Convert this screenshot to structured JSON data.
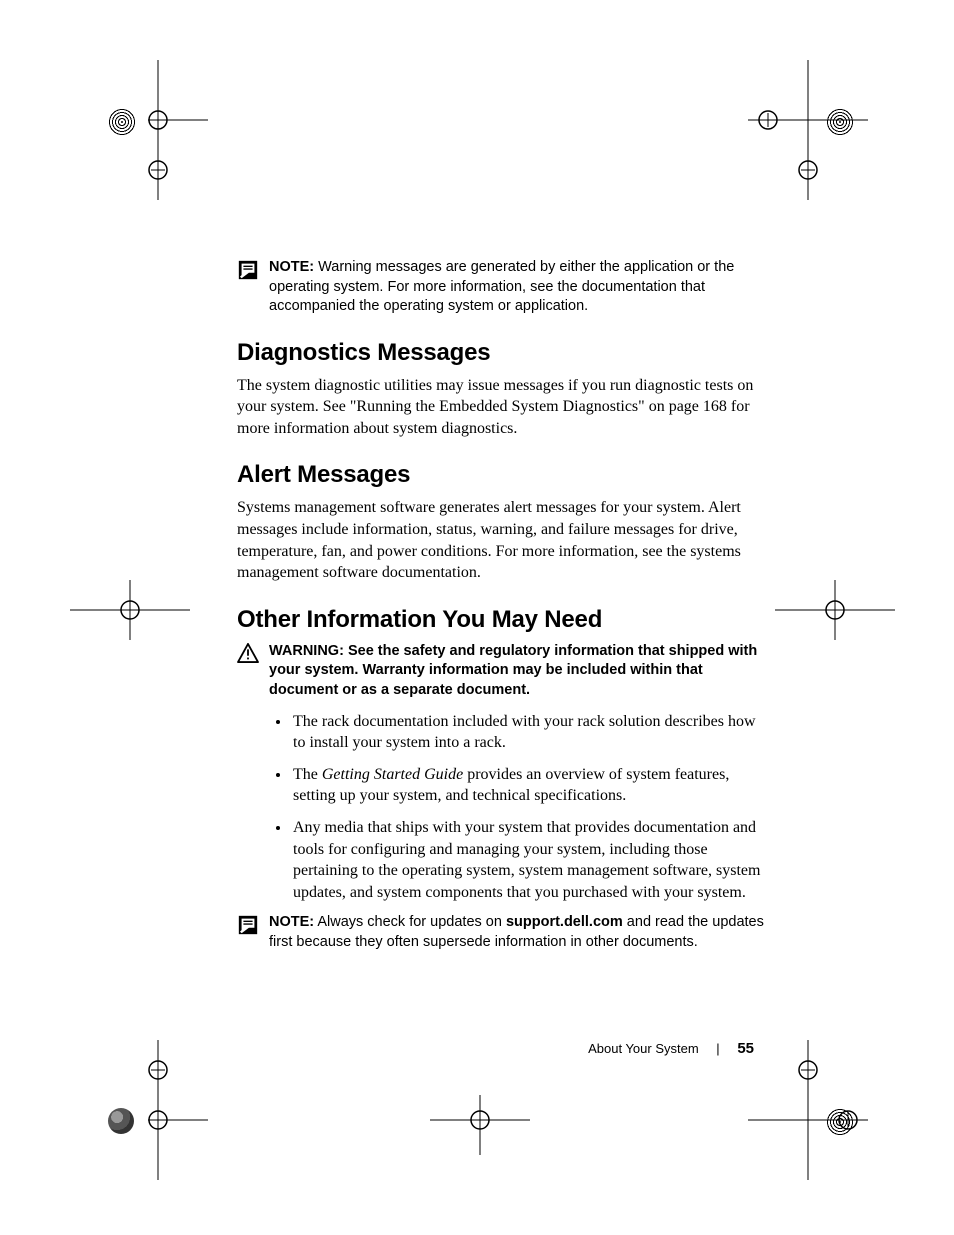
{
  "note1": {
    "label": "NOTE:",
    "text": "Warning messages are generated by either the application or the operating system. For more information, see the documentation that accompanied the operating system or application."
  },
  "h_diag": "Diagnostics Messages",
  "p_diag": "The system diagnostic utilities may issue messages if you run diagnostic tests on your system. See \"Running the Embedded System Diagnostics\" on page 168 for more information about system diagnostics.",
  "h_alert": "Alert Messages",
  "p_alert": "Systems management software generates alert messages for your system. Alert messages include information, status, warning, and failure messages for drive, temperature, fan, and power conditions. For more information, see the systems management software documentation.",
  "h_other": "Other Information You May Need",
  "warning": {
    "label": "WARNING:",
    "text": "See the safety and regulatory information that shipped with your system. Warranty information may be included within that document or as a separate document."
  },
  "bullets": {
    "b1": "The rack documentation included with your rack solution describes how to install your system into a rack.",
    "b2a": "The ",
    "b2_em": "Getting Started Guide",
    "b2b": " provides an overview of system features, setting up your system, and technical specifications.",
    "b3": "Any media that ships with your system that provides documentation and tools for configuring and managing your system, including those pertaining to the operating system, system management software, system updates, and system components that you purchased with your system."
  },
  "note2": {
    "label": "NOTE:",
    "pre": "Always check for updates on ",
    "bold": "support.dell.com",
    "post": " and read the updates first because they often supersede information in other documents."
  },
  "footer": {
    "section": "About Your System",
    "page": "55"
  }
}
